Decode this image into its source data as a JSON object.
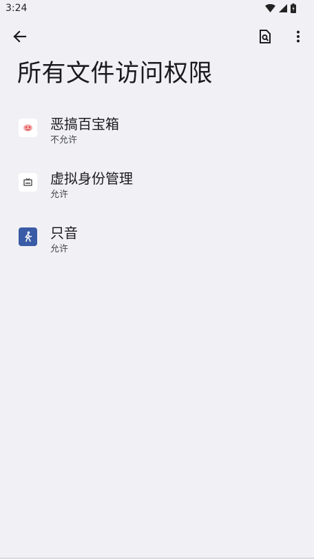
{
  "status_bar": {
    "time": "3:24"
  },
  "header": {
    "title": "所有文件访问权限"
  },
  "apps": [
    {
      "name": "恶搞百宝箱",
      "status": "不允许",
      "icon": "prank-toolbox-app-icon"
    },
    {
      "name": "虚拟身份管理",
      "status": "允许",
      "icon": "virtual-identity-app-icon"
    },
    {
      "name": "只音",
      "status": "允许",
      "icon": "zhiyin-app-icon"
    }
  ],
  "colors": {
    "background": "#f1f0f5",
    "text": "#1b1b1f",
    "secondary": "#44474f",
    "zhiyin_icon": "#3a5ba6"
  }
}
